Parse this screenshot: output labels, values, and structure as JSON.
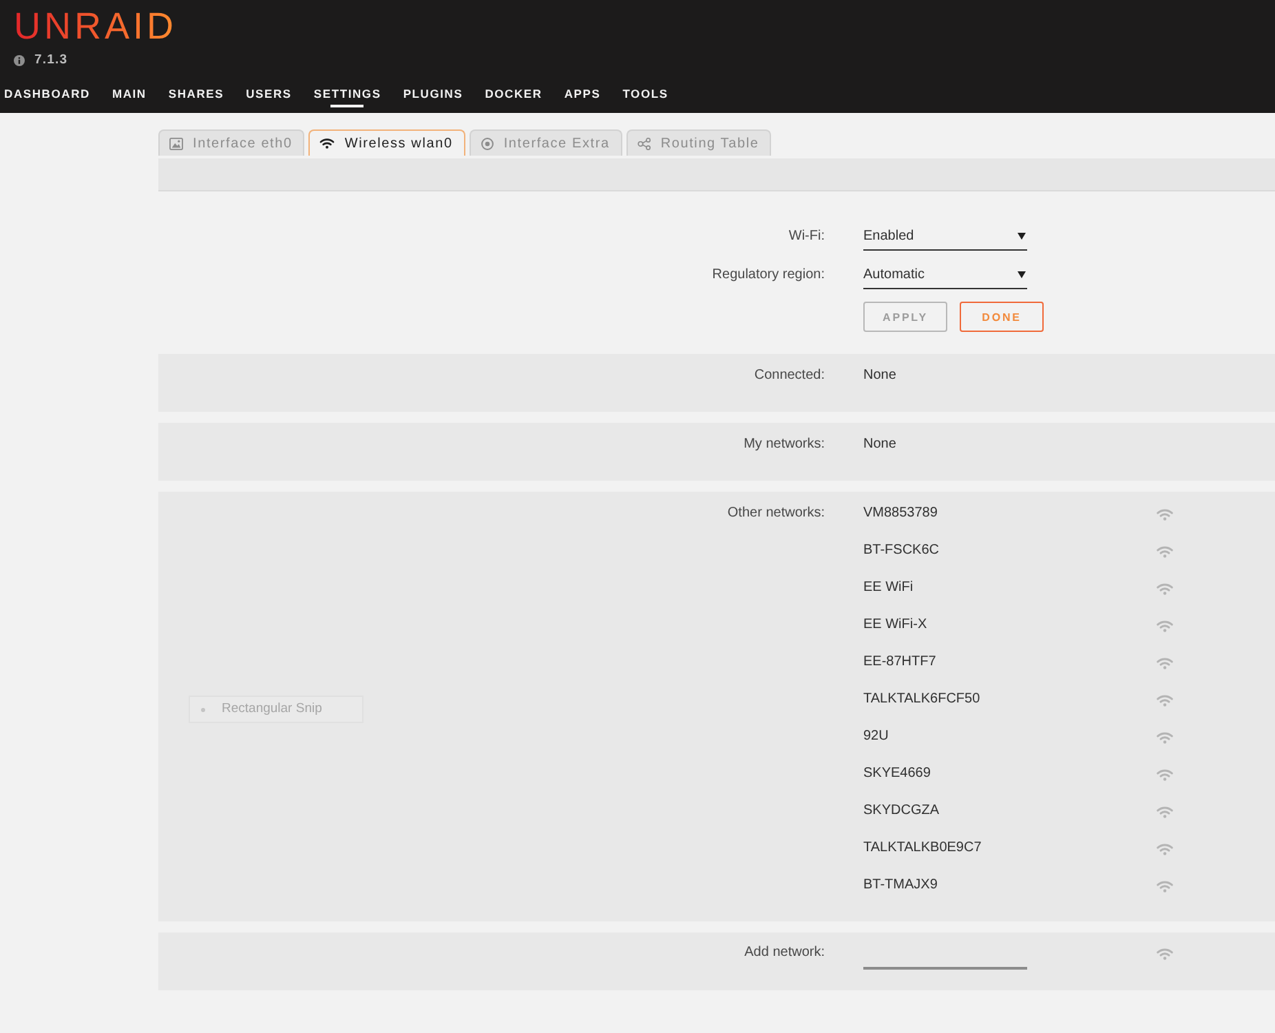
{
  "header": {
    "logo": "UNRAID",
    "version": "7.1.3"
  },
  "nav": [
    {
      "label": "DASHBOARD",
      "selected": false
    },
    {
      "label": "MAIN",
      "selected": false
    },
    {
      "label": "SHARES",
      "selected": false
    },
    {
      "label": "USERS",
      "selected": false
    },
    {
      "label": "SETTINGS",
      "selected": true
    },
    {
      "label": "PLUGINS",
      "selected": false
    },
    {
      "label": "DOCKER",
      "selected": false
    },
    {
      "label": "APPS",
      "selected": false
    },
    {
      "label": "TOOLS",
      "selected": false
    }
  ],
  "tabs": [
    {
      "label": "Interface eth0",
      "selected": false
    },
    {
      "label": "Wireless wlan0",
      "selected": true
    },
    {
      "label": "Interface Extra",
      "selected": false
    },
    {
      "label": "Routing Table",
      "selected": false
    }
  ],
  "settings": [
    {
      "label": "Wi-Fi:",
      "value": "Enabled"
    },
    {
      "label": "Regulatory region:",
      "value": "Automatic"
    }
  ],
  "buttons": [
    {
      "label": "APPLY",
      "disabled": true
    },
    {
      "label": "DONE",
      "disabled": false
    }
  ],
  "status": [
    {
      "label": "Connected:",
      "value": "None"
    },
    {
      "label": "My networks:",
      "value": "None"
    }
  ],
  "other_networks": {
    "label": "Other networks:",
    "networks": [
      "VM8853789",
      "BT-FSCK6C",
      "EE WiFi",
      "EE WiFi-X",
      "EE-87HTF7",
      "TALKTALK6FCF50",
      "92U",
      "SKYE4669",
      "SKYDCGZA",
      "TALKTALKB0E9C7",
      "BT-TMAJX9"
    ]
  },
  "add_network": {
    "label": "Add network:"
  },
  "overlay": {
    "text": "Rectangular Snip"
  }
}
